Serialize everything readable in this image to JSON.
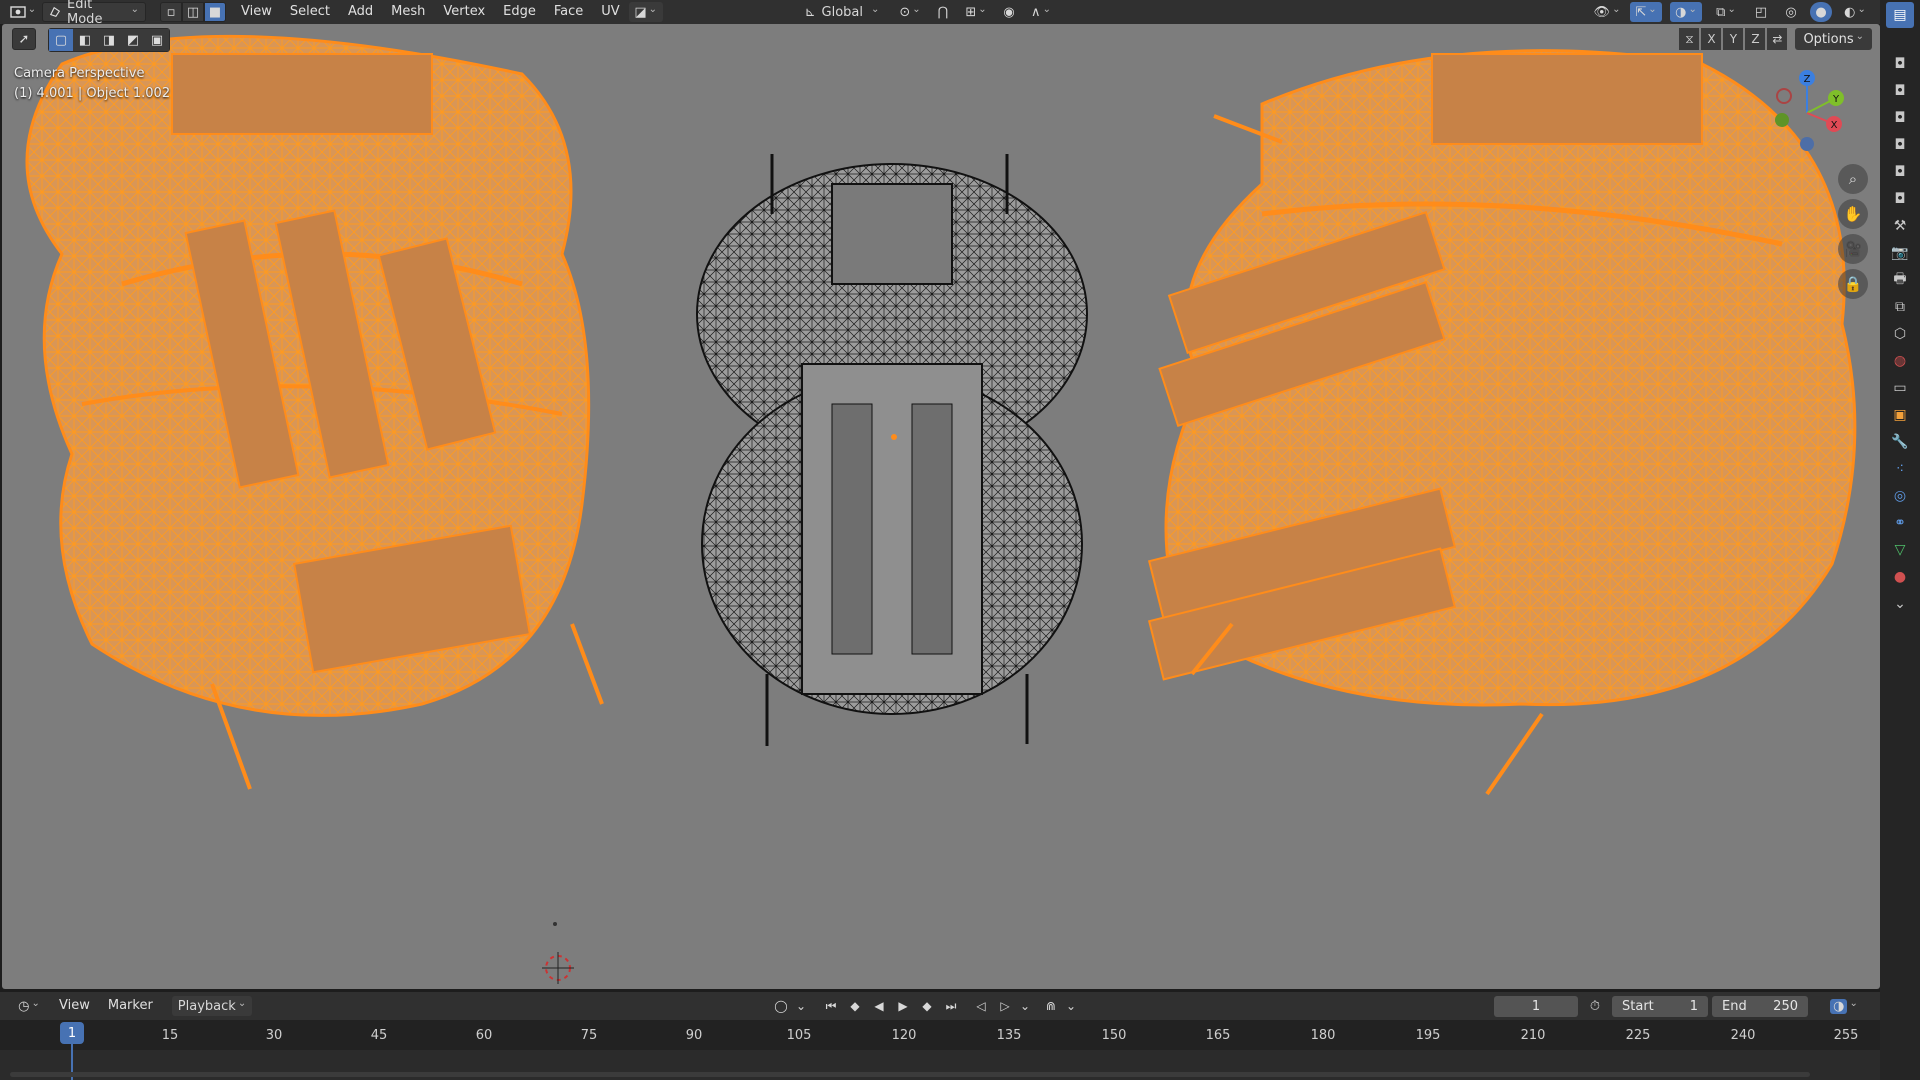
{
  "header": {
    "mode": "Edit Mode",
    "menu": [
      "View",
      "Select",
      "Add",
      "Mesh",
      "Vertex",
      "Edge",
      "Face",
      "UV"
    ],
    "orientation": "Global"
  },
  "viewport": {
    "perspective_label": "Camera Perspective",
    "object_label": "(1) 4.001 | Object 1.002",
    "axes": [
      "X",
      "Y",
      "Z"
    ],
    "options_label": "Options",
    "gizmo_axes": {
      "x": "X",
      "y": "Y",
      "z": "Z"
    }
  },
  "timeline": {
    "menu": [
      "View",
      "Marker"
    ],
    "playback_label": "Playback",
    "current_frame": "1",
    "start_label": "Start",
    "start_value": "1",
    "end_label": "End",
    "end_value": "250",
    "ticks": [
      "15",
      "30",
      "45",
      "60",
      "75",
      "90",
      "105",
      "120",
      "135",
      "150",
      "165",
      "180",
      "195",
      "210",
      "225",
      "240",
      "255"
    ],
    "playhead": "1"
  },
  "colors": {
    "selection": "#ff8c1a",
    "wire": "#111111",
    "viewport_bg": "#7d7d7d",
    "accent": "#4772b3"
  }
}
